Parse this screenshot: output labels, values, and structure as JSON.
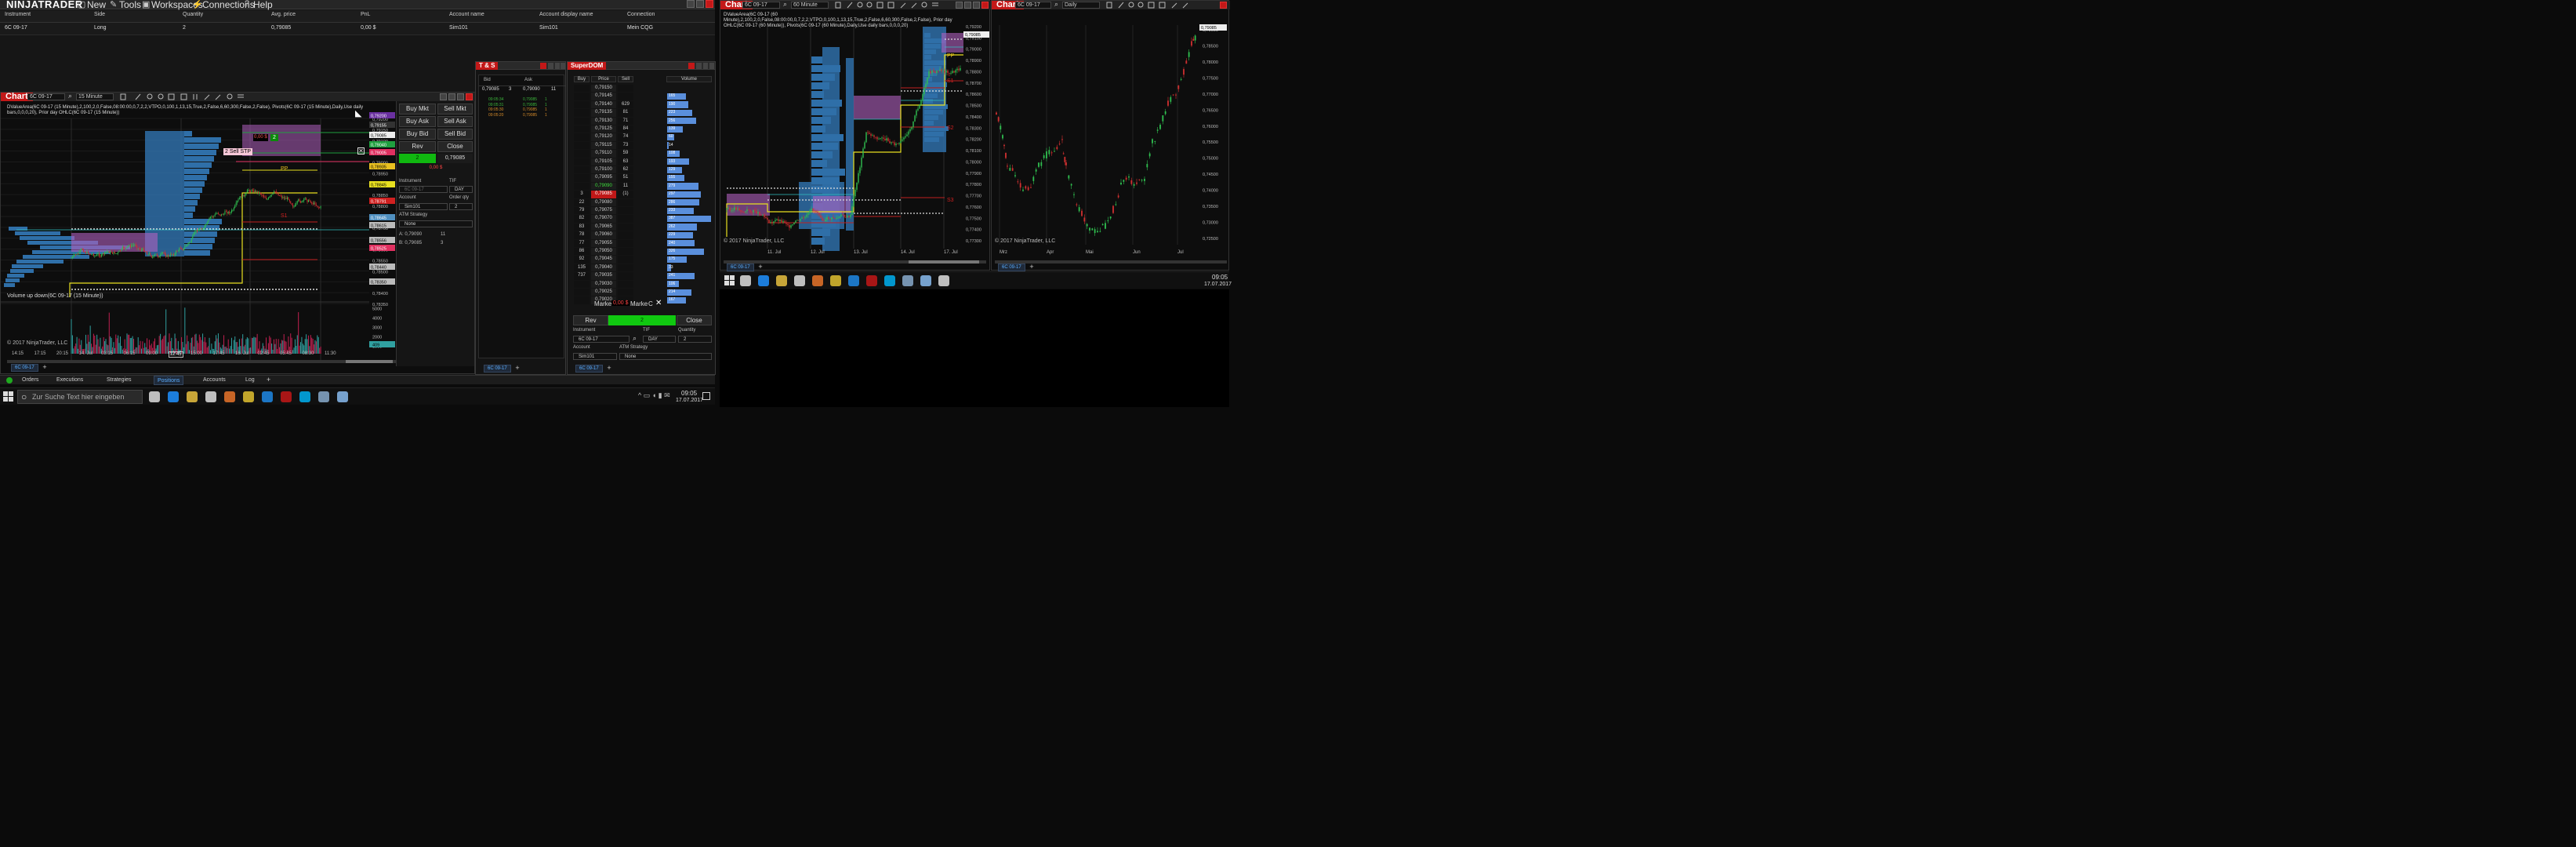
{
  "menu": {
    "logo": "NINJATRADER",
    "items": [
      "New",
      "Tools",
      "Workspaces",
      "Connections",
      "Help"
    ]
  },
  "positions": {
    "headers": [
      "Instrument",
      "Side",
      "Quantity",
      "Avg. price",
      "PnL",
      "Account name",
      "Account display name",
      "Connection"
    ],
    "row": [
      "6C 09-17",
      "Long",
      "2",
      "0,79085",
      "0,00 $",
      "Sim101",
      "Sim101",
      "Mein CQG"
    ]
  },
  "bottom_tabs": [
    "Orders",
    "Executions",
    "Strategies",
    "Positions",
    "Accounts",
    "Log"
  ],
  "bottom_active": "Positions",
  "chart1": {
    "tag": "Chart",
    "instrument": "6C 09-17",
    "interval": "15 Minute",
    "indicator_text": "DValueArea(6C 09-17 (15 Minute),2,100,2,0,False,08:00:00,0,7,2,2,VTPO,0,100,1,13,15,True,2,False,6,60,300,False,2,False), Pivots(6C 09-17 (15 Minute),Daily,Use daily bars,0,0,0,20), Prior day OHLC(6C 09-17 (15 Minute))",
    "volume_text": "Volume up down(6C 09-17 (15 Minute))",
    "copyright": "© 2017 NinjaTrader, LLC",
    "price_labels": [
      "0,79200",
      "0,79155",
      "0,79085",
      "0,79040",
      "0,79005",
      "0,78935",
      "0,78845",
      "0,78791",
      "0,78645",
      "0,78615",
      "0,78556",
      "0,78525",
      "0,78440",
      "0,78350"
    ],
    "price_axis": [
      "0,79200",
      "0,79150",
      "0,79100",
      "0,79050",
      "0,79000",
      "0,78950",
      "0,78900",
      "0,78850",
      "0,78800",
      "0,78750",
      "0,78700",
      "0,78650",
      "0,78600",
      "0,78550",
      "0,78500",
      "0,78450",
      "0,78400",
      "0,78350"
    ],
    "vol_axis": [
      "5000",
      "4000",
      "3000",
      "2000",
      "1000",
      "409"
    ],
    "time_axis": [
      "14:15",
      "17:15",
      "20:15",
      "14. Jul",
      "03:15",
      "06:15",
      "09:00",
      "12:45",
      "15:00",
      "17:45",
      "16. Jul",
      "02:45",
      "05:45",
      "08:30",
      "11:30"
    ],
    "order_qty_badge": "2",
    "order_price_badge": "0,00 $",
    "sell_stp_label": "2 Sell STP",
    "pp_label": "PP",
    "s1_label": "S1",
    "tab": "6C 09-17"
  },
  "chart_trader": {
    "buy_mkt": "Buy Mkt",
    "sell_mkt": "Sell Mkt",
    "buy_ask": "Buy Ask",
    "sell_ask": "Sell Ask",
    "buy_bid": "Buy Bid",
    "sell_bid": "Sell Bid",
    "rev": "Rev",
    "close": "Close",
    "position_qty": "2",
    "position_price": "0,79085",
    "pnl": "0,00 $",
    "instrument_label": "Instrument",
    "instrument_value": "6C 09-17",
    "tif_label": "TIF",
    "tif_value": "DAY",
    "account_label": "Account",
    "account_value": "Sim101",
    "order_qty_label": "Order qty",
    "order_qty_value": "2",
    "atm_label": "ATM Strategy",
    "atm_value": "None",
    "a_line": "A:  0,79090",
    "a_qty": "11",
    "b_line": "B:  0,79085",
    "b_qty": "3"
  },
  "ts": {
    "tag": "T & S",
    "bid_header": "Bid",
    "ask_header": "Ask",
    "bid_price": "0,79085",
    "bid_size": "3",
    "ask_price": "0,79090",
    "ask_size": "11",
    "rows": [
      {
        "time": "09:05:34",
        "price": "0,79085",
        "size": "1",
        "color": "#3bb53b"
      },
      {
        "time": "09:05:31",
        "price": "0,79085",
        "size": "1",
        "color": "#3bb53b"
      },
      {
        "time": "09:05:30",
        "price": "0,79085",
        "size": "1",
        "color": "#d48a2a"
      },
      {
        "time": "09:05:20",
        "price": "0,79085",
        "size": "1",
        "color": "#d48a2a"
      }
    ],
    "tab": "6C 09-17"
  },
  "superdom": {
    "tag": "SuperDOM",
    "headers": [
      "Buy",
      "Price",
      "Sell",
      "Volume"
    ],
    "rows": [
      {
        "buy": "",
        "price": "0,79150",
        "sell": "",
        "vol": "",
        "v": 0
      },
      {
        "buy": "",
        "price": "0,79145",
        "sell": "",
        "vol": "165",
        "v": 165
      },
      {
        "buy": "",
        "price": "0,79140",
        "sell": "629",
        "vol": "190",
        "v": 190
      },
      {
        "buy": "",
        "price": "0,79135",
        "sell": "81",
        "vol": "223",
        "v": 223
      },
      {
        "buy": "",
        "price": "0,79130",
        "sell": "71",
        "vol": "256",
        "v": 256
      },
      {
        "buy": "",
        "price": "0,79125",
        "sell": "84",
        "vol": "139",
        "v": 139
      },
      {
        "buy": "",
        "price": "0,79120",
        "sell": "74",
        "vol": "60",
        "v": 60
      },
      {
        "buy": "",
        "price": "0,79115",
        "sell": "73",
        "vol": "14",
        "v": 14
      },
      {
        "buy": "",
        "price": "0,79110",
        "sell": "59",
        "vol": "108",
        "v": 108
      },
      {
        "buy": "",
        "price": "0,79105",
        "sell": "63",
        "vol": "193",
        "v": 193
      },
      {
        "buy": "",
        "price": "0,79100",
        "sell": "62",
        "vol": "129",
        "v": 129
      },
      {
        "buy": "",
        "price": "0,79095",
        "sell": "51",
        "vol": "155",
        "v": 155
      },
      {
        "buy": "",
        "price": "0,79090",
        "sell": "11",
        "vol": "279",
        "v": 279
      },
      {
        "buy": "3",
        "price": "0,79085",
        "sell": "(1)",
        "vol": "297",
        "v": 297
      },
      {
        "buy": "22",
        "price": "0,79080",
        "sell": "",
        "vol": "286",
        "v": 286
      },
      {
        "buy": "79",
        "price": "0,79075",
        "sell": "",
        "vol": "233",
        "v": 233
      },
      {
        "buy": "82",
        "price": "0,79070",
        "sell": "",
        "vol": "387",
        "v": 387
      },
      {
        "buy": "83",
        "price": "0,79065",
        "sell": "",
        "vol": "262",
        "v": 262
      },
      {
        "buy": "78",
        "price": "0,79060",
        "sell": "",
        "vol": "229",
        "v": 229
      },
      {
        "buy": "77",
        "price": "0,79055",
        "sell": "",
        "vol": "240",
        "v": 240
      },
      {
        "buy": "86",
        "price": "0,79050",
        "sell": "",
        "vol": "326",
        "v": 326
      },
      {
        "buy": "92",
        "price": "0,79045",
        "sell": "",
        "vol": "175",
        "v": 175
      },
      {
        "buy": "135",
        "price": "0,79040",
        "sell": "",
        "vol": "33",
        "v": 33
      },
      {
        "buy": "737",
        "price": "0,79035",
        "sell": "",
        "vol": "241",
        "v": 241
      },
      {
        "buy": "",
        "price": "0,79030",
        "sell": "",
        "vol": "106",
        "v": 106
      },
      {
        "buy": "",
        "price": "0,79025",
        "sell": "",
        "vol": "214",
        "v": 214
      },
      {
        "buy": "",
        "price": "0,79020",
        "sell": "",
        "vol": "167",
        "v": 167
      }
    ],
    "market_left": "Marke",
    "pnl": "0,00 $",
    "market_right": "Marke",
    "c": "C",
    "rev": "Rev",
    "position_qty": "2",
    "close": "Close",
    "instrument_label": "Instrument",
    "instrument_value": "6C 09-17",
    "tif_label": "TIF",
    "tif_value": "DAY",
    "qty_label": "Quantity",
    "qty_value": "2",
    "account_label": "Account",
    "account_value": "Sim101",
    "atm_label": "ATM Strategy",
    "atm_value": "None",
    "tab": "6C 09-17"
  },
  "chart2": {
    "tag": "Chart",
    "instrument": "6C 09-17",
    "interval": "60 Minute",
    "indicator_text": "DValueArea(6C 09-17 (60 Minute),2,100,2,0,False,08:00:00,0,7,2,2,VTPO,0,100,1,13,15,True,2,False,6,60,300,False,2,False), Prior day OHLC(6C 09-17 (60 Minute)), Pivots(6C 09-17 (60 Minute),Daily,Use daily bars,0,0,0,20)",
    "price_axis": [
      "0,79200",
      "0,79100",
      "0,79000",
      "0,78900",
      "0,78800",
      "0,78700",
      "0,78600",
      "0,78500",
      "0,78400",
      "0,78300",
      "0,78200",
      "0,78100",
      "0,78000",
      "0,77900",
      "0,77800",
      "0,77700",
      "0,77600",
      "0,77500",
      "0,77400",
      "0,77300"
    ],
    "last_price": "0,79085",
    "time_axis": [
      "11. Jul",
      "12. Jul",
      "13. Jul",
      "14. Jul",
      "17. Jul"
    ],
    "pp_label": "PP",
    "s1_label": "S1",
    "s2_label": "S2",
    "s3_label": "S3",
    "copyright": "© 2017 NinjaTrader, LLC",
    "tab": "6C 09-17"
  },
  "chart3": {
    "tag": "Chart",
    "instrument": "6C 09-17",
    "interval": "Daily",
    "price_axis": [
      "0,79000",
      "0,78500",
      "0,78000",
      "0,77500",
      "0,77000",
      "0,76500",
      "0,76000",
      "0,75500",
      "0,75000",
      "0,74500",
      "0,74000",
      "0,73500",
      "0,73000",
      "0,72500"
    ],
    "last_price": "0,79085",
    "time_axis": [
      "Mrz",
      "Apr",
      "Mai",
      "Jun",
      "Jul"
    ],
    "copyright": "© 2017 NinjaTrader, LLC",
    "tab": "6C 09-17"
  },
  "taskbar_left": {
    "search_placeholder": "Zur Suche Text hier eingeben",
    "time": "09:05",
    "date": "17.07.2017"
  },
  "taskbar_right": {
    "time": "09:05",
    "date": "17.07.2017"
  }
}
